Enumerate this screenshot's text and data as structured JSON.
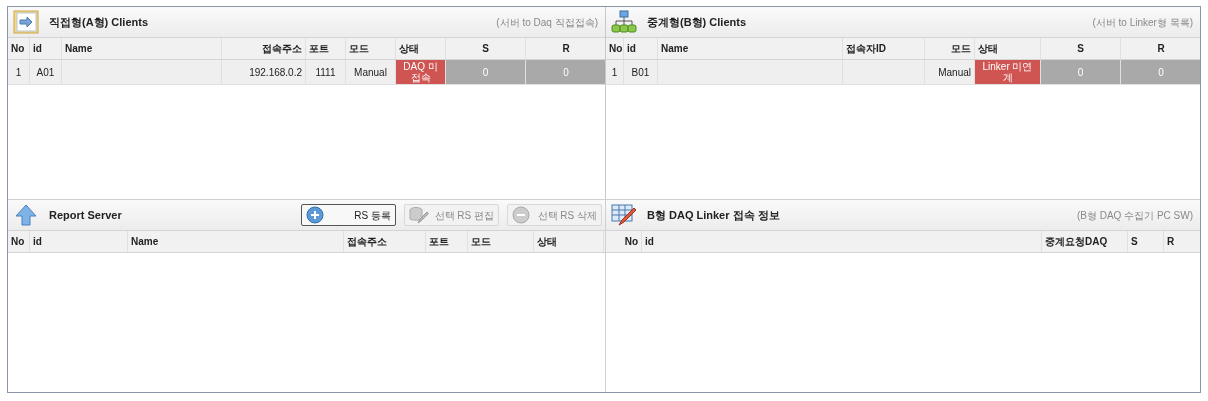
{
  "panels": [
    {
      "kind": "direct",
      "title": "직접형(A형) Clients",
      "subtitle": "(서버 to Daq 직접접속)",
      "columns": [
        "No",
        "id",
        "Name",
        "접속주소",
        "포트",
        "모드",
        "상태",
        "S",
        "R"
      ],
      "rows": [
        {
          "selected": true,
          "cells": [
            "1",
            "A01",
            "",
            "192.168.0.2",
            "1111",
            "Manual",
            "DAQ 미접속",
            "0",
            "0"
          ],
          "color": "#cf5552"
        }
      ]
    },
    {
      "kind": "relay",
      "title": "중계형(B형) Clients",
      "subtitle": "(서버 to Linker형 목록)",
      "columns": [
        "No",
        "id",
        "Name",
        "접속자ID",
        "모드",
        "상태",
        "S",
        "R"
      ],
      "rows": [
        {
          "selected": true,
          "cells": [
            "1",
            "B01",
            "",
            "",
            "Manual",
            "Linker 미연계",
            "0",
            "0"
          ],
          "color": "#cf5552"
        }
      ]
    },
    {
      "kind": "report",
      "title": "Report Server",
      "buttons": [
        {
          "label": "RS 등록",
          "disabled": false
        },
        {
          "label": "선택 RS 편집",
          "disabled": true
        },
        {
          "label": "선택 RS 삭제",
          "disabled": true
        }
      ],
      "columns": [
        "No",
        "id",
        "Name",
        "접속주소",
        "포트",
        "모드",
        "상태"
      ]
    },
    {
      "kind": "linker",
      "title": "B형 DAQ Linker 접속 정보",
      "subtitle": "(B형 DAQ 수집기 PC SW)",
      "columns": [
        "No",
        "id",
        "중계요청DAQ",
        "S",
        "R"
      ]
    }
  ]
}
